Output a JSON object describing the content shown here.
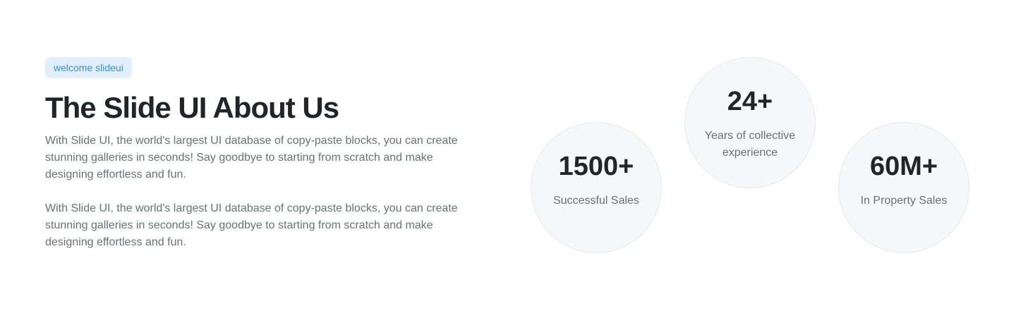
{
  "about": {
    "badge": "welcome slideui",
    "title": "The Slide UI About Us",
    "paragraphs": [
      "With Slide UI, the world's largest UI database of copy-paste blocks, you can create stunning galleries in seconds! Say goodbye to starting from scratch and make designing effortless and fun.",
      "With Slide UI, the world's largest UI database of copy-paste blocks, you can create stunning galleries in seconds! Say goodbye to starting from scratch and make designing effortless and fun."
    ]
  },
  "stats": [
    {
      "value": "1500+",
      "label": "Successful Sales"
    },
    {
      "value": "24+",
      "label": "Years of collective experience"
    },
    {
      "value": "60M+",
      "label": "In Property Sales"
    }
  ],
  "colors": {
    "badge_bg": "#e1effc",
    "badge_text": "#3b8fd9",
    "heading": "#212529",
    "body_text": "#6b7075",
    "circle_bg": "#f6f7f8"
  }
}
